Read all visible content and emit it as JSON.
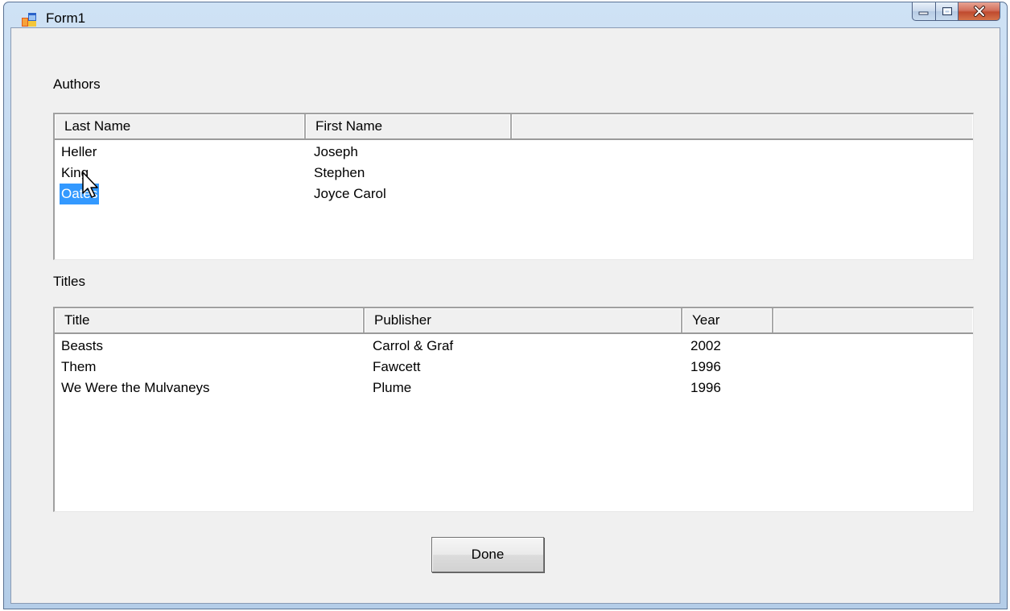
{
  "window": {
    "title": "Form1",
    "icon": "app-form-icon",
    "controls": [
      "minimize-icon",
      "maximize-icon",
      "close-icon"
    ]
  },
  "authors": {
    "label": "Authors",
    "columns": [
      "Last Name",
      "First Name"
    ],
    "rows": [
      {
        "last": "Heller",
        "first": "Joseph",
        "selected": false
      },
      {
        "last": "King",
        "first": "Stephen",
        "selected": false
      },
      {
        "last": "Oates",
        "first": "Joyce Carol",
        "selected": true
      }
    ]
  },
  "titles": {
    "label": "Titles",
    "columns": [
      "Title",
      "Publisher",
      "Year"
    ],
    "rows": [
      {
        "title": "Beasts",
        "publisher": "Carrol & Graf",
        "year": "2002"
      },
      {
        "title": "Them",
        "publisher": "Fawcett",
        "year": "1996"
      },
      {
        "title": "We Were the Mulvaneys",
        "publisher": "Plume",
        "year": "1996"
      }
    ]
  },
  "done_label": "Done",
  "colors": {
    "selection": "#3399ff",
    "client_bg": "#f0f0f0",
    "close_button": "#c04a2f"
  }
}
